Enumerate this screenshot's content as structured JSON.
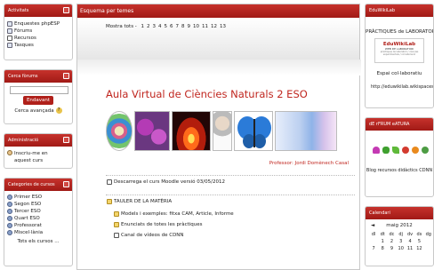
{
  "activitats": {
    "title": "Activitats",
    "items": [
      "Enquestes phpESP",
      "Fòrums",
      "Recursos",
      "Tasques"
    ]
  },
  "cerca": {
    "title": "Cerca fòrums",
    "button": "Endavant",
    "advanced": "Cerca avançada"
  },
  "administracio": {
    "title": "Administració",
    "item": "Inscriu-me en aquest curs"
  },
  "categories": {
    "title": "Categories de cursos",
    "items": [
      "Primer ESO",
      "Segon ESO",
      "Tercer ESO",
      "Quart ESO",
      "Professorat",
      "Miscel·lània"
    ],
    "all": "Tots els cursos ..."
  },
  "main": {
    "title": "Esquema per temes",
    "paging_label": "Mostra tots -",
    "pages": [
      "1",
      "2",
      "3",
      "4",
      "5",
      "6",
      "7",
      "8",
      "9",
      "10",
      "11",
      "12",
      "13"
    ],
    "course_title": "Aula Virtual de Ciències Naturals 2 ESO",
    "teacher": "Professor: Jordi Domènech Casal",
    "download": "Descarrega el curs Moodle versió 03/05/2012",
    "section": "TAULER DE LA MATÈRIA",
    "resources": [
      "Models i exemples: fitxa CAM, Article, Informe",
      "Enunciats de totes les pràctiques",
      "Canal de vídeos de CDNN"
    ]
  },
  "edu": {
    "title": "EduWikiLab",
    "subtitle": "PRÀCTIQUES de LABORATORI",
    "logo": "EduWikiLab",
    "logo_sub": "WEB DE LABORATORI",
    "logo_tag": "pràctiques de laboratori / ciències experimentals / col·laboració",
    "space": "Espai col·laboratiu",
    "url": "http://eduwikilab.wikispaces.com"
  },
  "forum": {
    "title": "dE rFRUM eATURA",
    "caption": "Blog recursos didàctics CDNN"
  },
  "calendar": {
    "title": "Calendari",
    "month": "maig 2012",
    "days": [
      "dl",
      "dt",
      "dc",
      "dj",
      "dv",
      "ds",
      "dg"
    ],
    "rows": [
      [
        "",
        "1",
        "2",
        "3",
        "4",
        "5",
        ""
      ],
      [
        "7",
        "8",
        "9",
        "10",
        "11",
        "12",
        ""
      ]
    ]
  }
}
